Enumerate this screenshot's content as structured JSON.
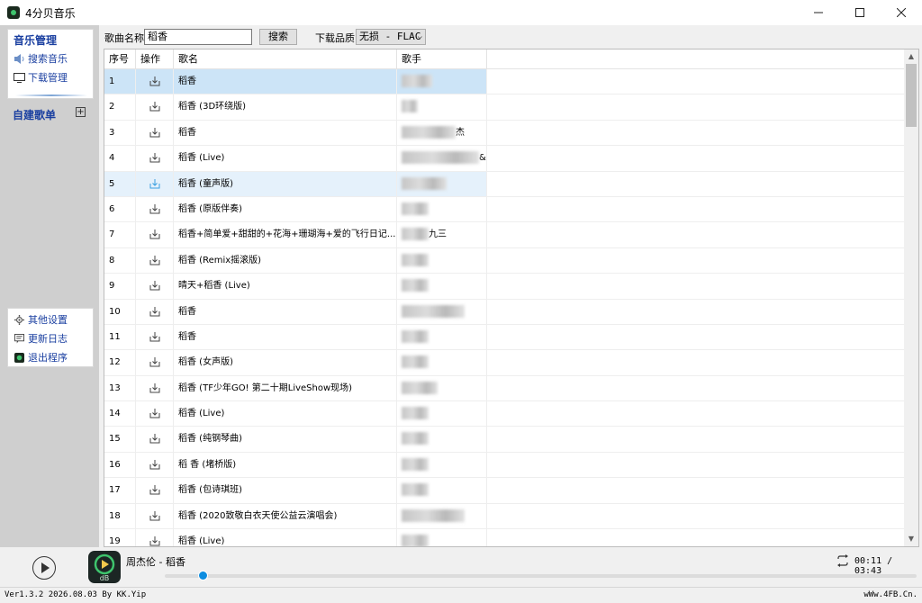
{
  "window": {
    "title": "4分贝音乐"
  },
  "sidebar": {
    "music_manage": "音乐管理",
    "search_music": "搜索音乐",
    "download_manage": "下载管理",
    "custom_playlist": "自建歌单",
    "other_settings": "其他设置",
    "update_log": "更新日志",
    "exit": "退出程序"
  },
  "search": {
    "label": "歌曲名称",
    "value": "稻香",
    "button": "搜索",
    "quality_label": "下载品质",
    "quality_value": "无损 - FLAC"
  },
  "table": {
    "headers": {
      "index": "序号",
      "action": "操作",
      "name": "歌名",
      "artist": "歌手"
    },
    "rows": [
      {
        "index": "1",
        "name": "稻香",
        "artist": ""
      },
      {
        "index": "2",
        "name": "稻香 (3D环绕版)",
        "artist": ""
      },
      {
        "index": "3",
        "name": "稻香",
        "artist": "杰"
      },
      {
        "index": "4",
        "name": "稻香 (Live)",
        "artist": "&..."
      },
      {
        "index": "5",
        "name": "稻香 (童声版)",
        "artist": ""
      },
      {
        "index": "6",
        "name": "稻香 (原版伴奏)",
        "artist": ""
      },
      {
        "index": "7",
        "name": "稻香+简单爱+甜甜的+花海+珊瑚海+爱的飞行日记...",
        "artist": "九三"
      },
      {
        "index": "8",
        "name": "稻香 (Remix摇滚版)",
        "artist": ""
      },
      {
        "index": "9",
        "name": "晴天+稻香 (Live)",
        "artist": ""
      },
      {
        "index": "10",
        "name": "稻香",
        "artist": ""
      },
      {
        "index": "11",
        "name": "稻香",
        "artist": ""
      },
      {
        "index": "12",
        "name": "稻香 (女声版)",
        "artist": ""
      },
      {
        "index": "13",
        "name": "稻香 (TF少年GO! 第二十期LiveShow现场)",
        "artist": ""
      },
      {
        "index": "14",
        "name": "稻香 (Live)",
        "artist": ""
      },
      {
        "index": "15",
        "name": "稻香 (纯钢琴曲)",
        "artist": ""
      },
      {
        "index": "16",
        "name": "稻 香 (堵桥版)",
        "artist": ""
      },
      {
        "index": "17",
        "name": "稻香 (包诗琪班)",
        "artist": ""
      },
      {
        "index": "18",
        "name": "稻香 (2020致敬白衣天使公益云演唱会)",
        "artist": ""
      },
      {
        "index": "19",
        "name": "稻香 (Live)",
        "artist": ""
      }
    ]
  },
  "player": {
    "now_playing": "周杰伦 - 稻香",
    "cover_label": "dB",
    "current_time": "00:11",
    "total_time": "03:43",
    "time_display": "00:11 / 03:43",
    "progress": 0.05
  },
  "status": {
    "version": "Ver1.3.2 2026.08.03 By KK.Yip",
    "site": "wWw.4FB.Cn."
  }
}
